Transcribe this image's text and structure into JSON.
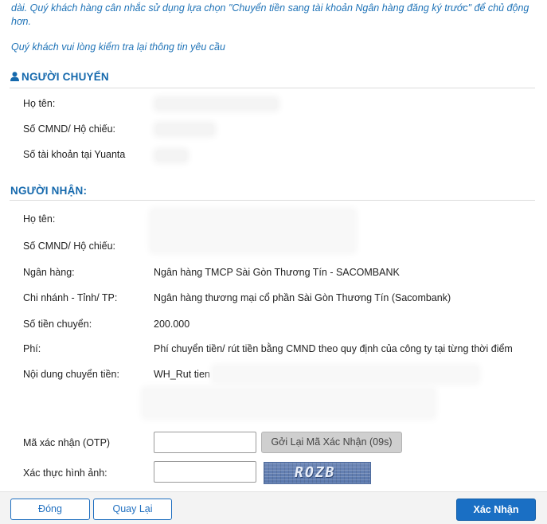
{
  "notice": {
    "text": "dài. Quý khách hàng cân nhắc sử dụng lựa chọn \"Chuyển tiền sang tài khoản Ngân hàng đăng ký trước\" để chủ động hơn.",
    "check": "Quý khách vui lòng kiểm tra lại thông tin yêu cầu"
  },
  "sender": {
    "title": "NGƯỜI CHUYỂN",
    "icon": "user-icon",
    "fields": [
      {
        "label": "Họ tên:"
      },
      {
        "label": "Số CMND/ Hộ chiếu:"
      },
      {
        "label": "Số tài khoản tại Yuanta"
      }
    ]
  },
  "receiver": {
    "title": "NGƯỜI NHẬN:",
    "fields": [
      {
        "label": "Họ tên:",
        "value": ""
      },
      {
        "label": "Số CMND/ Hộ chiếu:",
        "value": ""
      },
      {
        "label": "Ngân hàng:",
        "value": "Ngân hàng TMCP Sài Gòn Thương Tín - SACOMBANK"
      },
      {
        "label": "Chi nhánh - Tỉnh/ TP:",
        "value": "Ngân hàng thương mại cổ phần Sài Gòn Thương Tín (Sacombank)"
      },
      {
        "label": "Số tiền chuyển:",
        "value": "200.000"
      },
      {
        "label": "Phí:",
        "value": "Phí chuyển tiền/ rút tiền bằng CMND theo quy định của công ty tại từng thời điểm"
      },
      {
        "label": "Nội dung chuyển tiền:",
        "value": "WH_Rut tien"
      }
    ]
  },
  "otp": {
    "label": "Mã xác nhận (OTP)",
    "value": "",
    "resend_label": "Gởi Lại Mã Xác Nhận (09s)"
  },
  "captcha": {
    "label": "Xác thực hình ảnh:",
    "value": "",
    "image_text": "ROZB"
  },
  "buttons": {
    "close": "Đóng",
    "back": "Quay Lại",
    "confirm": "Xác Nhận"
  },
  "colors": {
    "accent": "#1a6fc4",
    "heading": "#1569ad",
    "notice_text": "#1f73b7"
  }
}
